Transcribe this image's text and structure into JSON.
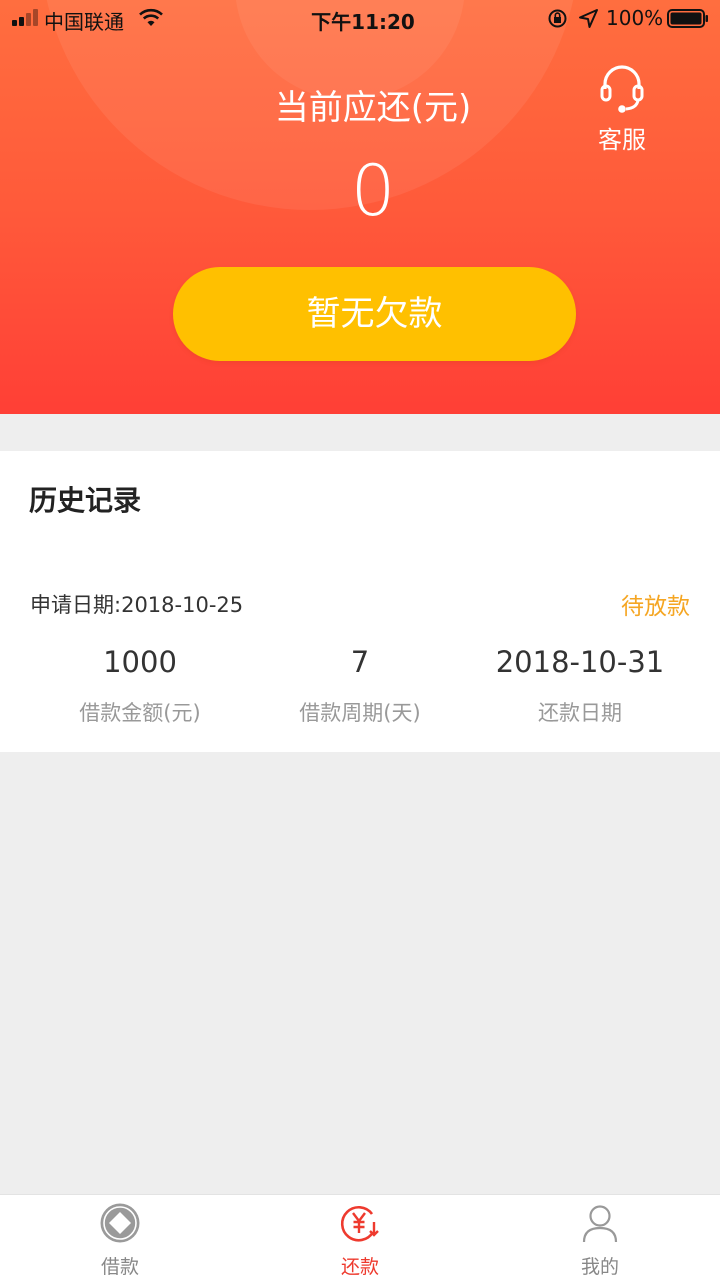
{
  "status_bar": {
    "carrier": "中国联通",
    "time": "下午11:20",
    "battery": "100%"
  },
  "header": {
    "customer_service_label": "客服",
    "due_title": "当前应还(元)",
    "due_amount": "0",
    "no_debt_button": "暂无欠款"
  },
  "history": {
    "title": "历史记录",
    "records": [
      {
        "apply_date_label": "申请日期:",
        "apply_date": "2018-10-25",
        "status": "待放款",
        "amount": "1000",
        "amount_label": "借款金额(元)",
        "period": "7",
        "period_label": "借款周期(天)",
        "repay_date": "2018-10-31",
        "repay_date_label": "还款日期"
      }
    ]
  },
  "tabs": [
    {
      "label": "借款",
      "icon": "coin-icon",
      "active": false
    },
    {
      "label": "还款",
      "icon": "yen-repay-icon",
      "active": true
    },
    {
      "label": "我的",
      "icon": "user-icon",
      "active": false
    }
  ],
  "colors": {
    "header_gradient_top": "#ff6e3f",
    "header_gradient_bottom": "#ff3f36",
    "button": "#ffc000",
    "status_pending": "#f5a623",
    "tab_active": "#ee3a2e",
    "tab_inactive": "#888888"
  }
}
